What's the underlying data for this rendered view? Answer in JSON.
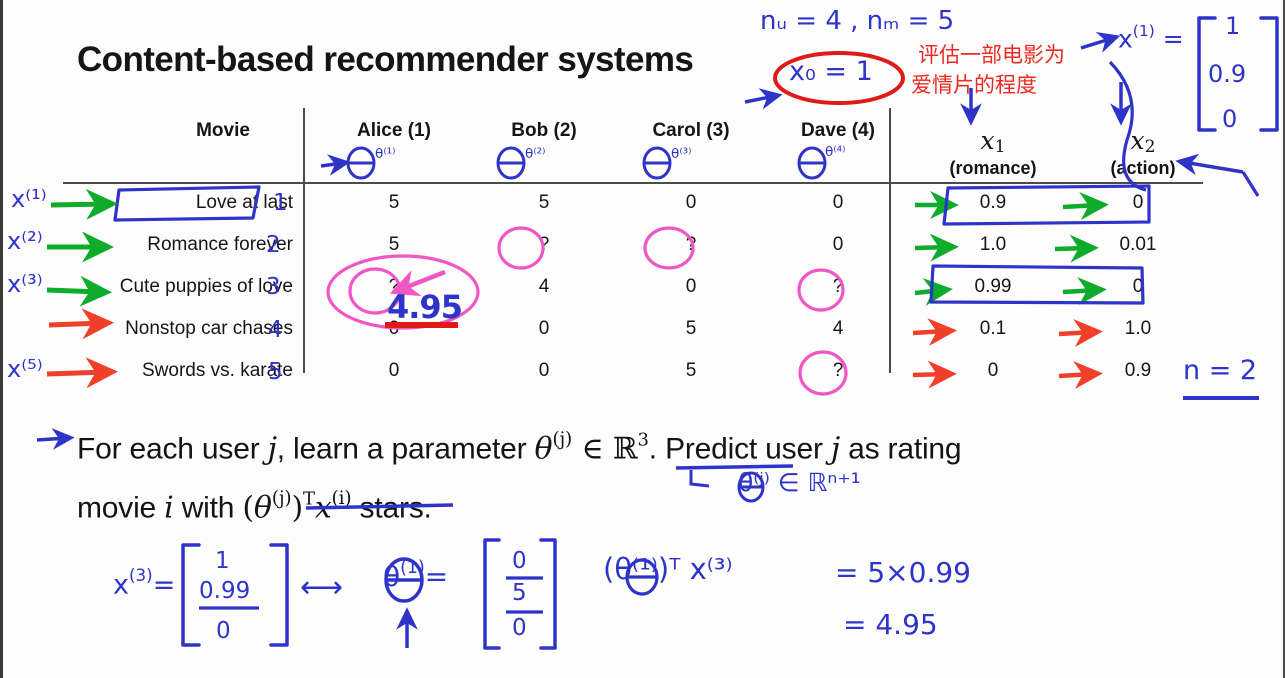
{
  "slide": {
    "title": "Content-based recommender systems",
    "background": "#fdfdfd"
  },
  "table": {
    "columns": [
      {
        "id": "movie",
        "label": "Movie"
      },
      {
        "id": "alice",
        "label": "Alice (1)",
        "theta": "θ⁽¹⁾"
      },
      {
        "id": "bob",
        "label": "Bob (2)",
        "theta": "θ⁽²⁾"
      },
      {
        "id": "carol",
        "label": "Carol (3)",
        "theta": "θ⁽³⁾"
      },
      {
        "id": "dave",
        "label": "Dave (4)",
        "theta": "θ⁽⁴⁾"
      },
      {
        "id": "x1",
        "label": "x1",
        "caption": "(romance)"
      },
      {
        "id": "x2",
        "label": "x2",
        "caption": "(action)"
      }
    ],
    "rows": [
      {
        "movie": "Love at last",
        "index": "1",
        "alice": "5",
        "bob": "5",
        "carol": "0",
        "dave": "0",
        "x1": "0.9",
        "x2": "0"
      },
      {
        "movie": "Romance forever",
        "index": "2",
        "alice": "5",
        "bob": "?",
        "carol": "?",
        "dave": "0",
        "x1": "1.0",
        "x2": "0.01"
      },
      {
        "movie": "Cute puppies of love",
        "index": "3",
        "alice": "?",
        "bob": "4",
        "carol": "0",
        "dave": "?",
        "x1": "0.99",
        "x2": "0"
      },
      {
        "movie": "Nonstop car chases",
        "index": "4",
        "alice": "0",
        "bob": "0",
        "carol": "5",
        "dave": "4",
        "x1": "0.1",
        "x2": "1.0"
      },
      {
        "movie": "Swords vs. karate",
        "index": "5",
        "alice": "0",
        "bob": "0",
        "carol": "5",
        "dave": "?",
        "x1": "0",
        "x2": "0.9"
      }
    ]
  },
  "body": {
    "line1_a": "For each user ",
    "line1_j": "j",
    "line1_b": ", learn a parameter ",
    "theta": "θ",
    "theta_sup": "(j)",
    "in": " ∈ ",
    "reals": "ℝ",
    "reals_sup": "3",
    "line1_c": ". Predict user ",
    "line1_j2": "j",
    "line1_d": " as rating",
    "line2_a": "movie ",
    "line2_i": "i",
    "line2_b": " with ",
    "expr_open": "(",
    "expr_theta": "θ",
    "expr_theta_sup": "(j)",
    "expr_close": ")",
    "expr_T": "T",
    "expr_x": "x",
    "expr_x_sup": "(i)",
    "line2_c": " stars."
  },
  "annotations": {
    "nu_nm": "nᵤ = 4 , nₘ = 5",
    "x0_eq_1": "x₀ = 1",
    "chinese_line1": "评估一部电影为",
    "chinese_line2": "爱情片的程度",
    "x1_vector_label": "x",
    "x1_vector_sup": "(1)",
    "x1_vector_eq": "=",
    "x1_vector_values": [
      "1",
      "0.9",
      "0"
    ],
    "n_equals_2": "n = 2",
    "theta_in_Rn1": "θ⁽ʲ⁾ ∈ ℝⁿ⁺¹",
    "pink_prediction": "4.95",
    "movie_indices": [
      "1",
      "2",
      "3",
      "4",
      "5"
    ],
    "left_x_labels": [
      "x⁽¹⁾",
      "x⁽²⁾",
      "x⁽³⁾",
      "x⁽⁵⁾"
    ]
  },
  "work": {
    "x3_label": "x",
    "x3_sup": "(3)",
    "x3_eq": "=",
    "x3_values": [
      "1",
      "0.99",
      "0"
    ],
    "arrow": "⟷",
    "theta1_label": "θ",
    "theta1_sup": "(1)",
    "theta1_eq": "=",
    "theta1_values": [
      "0",
      "5",
      "0"
    ],
    "dot_expr": "(θ⁽¹⁾)ᵀ x⁽³⁾",
    "dot_eq1": "= 5×0.99",
    "dot_eq2": "= 4.95"
  },
  "colors": {
    "ink_blue": "#2f34c8",
    "ink_red": "#ef2a22",
    "ink_green": "#0fab2b",
    "ink_pink": "#f056c4",
    "ink_orange": "#f0402a",
    "rule": "#4b4b4b",
    "text": "#151515"
  }
}
